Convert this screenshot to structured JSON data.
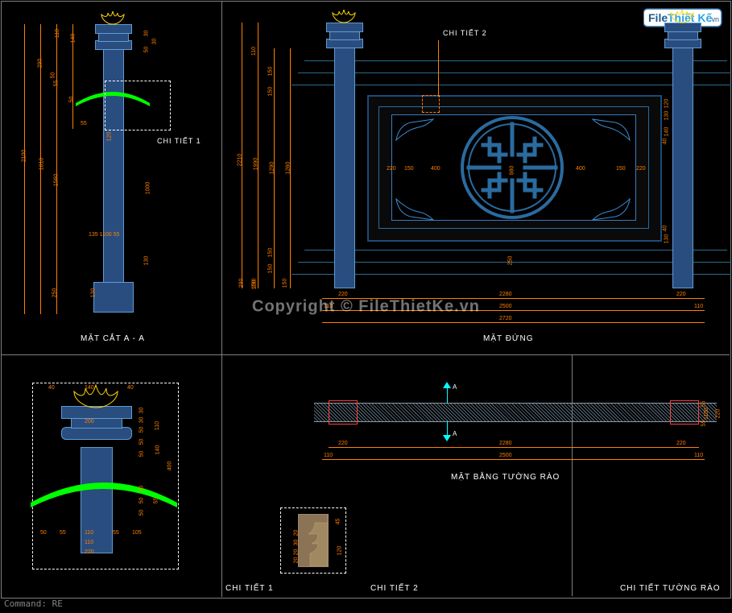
{
  "logo": {
    "text1": "File",
    "text2": "Thiết Kế",
    "text3": ".vn"
  },
  "watermark_center": "Copyright © FileThietKe.vn",
  "command_line": "Command: RE",
  "labels": {
    "section_aa": "MẶT CẮT A - A",
    "detail1_top": "CHI TIẾT 1",
    "detail2_top": "CHI TIẾT 2",
    "elevation": "MẶT ĐỨNG",
    "plan": "MẶT BẰNG TƯỜNG RÀO",
    "detail1_bottom": "CHI TIẾT 1",
    "detail2_bottom": "CHI TIẾT 2",
    "wall_detail": "CHI TIẾT TƯỜNG RÀO"
  },
  "dims": {
    "sec_v": [
      "110",
      "140",
      "30",
      "30",
      "50",
      "290",
      "50",
      "55",
      "50",
      "120",
      "2100",
      "1810",
      "1560",
      "1000",
      "130",
      "1100",
      "55",
      "135",
      "250",
      "130"
    ],
    "elev_v": [
      "110",
      "150",
      "150",
      "290",
      "1990",
      "1290",
      "1260",
      "2210",
      "100",
      "150",
      "150",
      "150",
      "290",
      "120",
      "130",
      "40",
      "140",
      "130",
      "40",
      "250"
    ],
    "elev_h": [
      "110",
      "220",
      "150",
      "400",
      "980",
      "400",
      "150",
      "220",
      "110",
      "220",
      "2280",
      "220",
      "2500",
      "2720"
    ],
    "plan_h": [
      "220",
      "110",
      "2280",
      "2500",
      "220",
      "110"
    ],
    "plan_v": [
      "55",
      "1100",
      "55",
      "220"
    ],
    "d1_h": [
      "40",
      "140",
      "40",
      "55",
      "110",
      "55",
      "105",
      "50",
      "110",
      "200",
      "220"
    ],
    "d1_v": [
      "30",
      "30",
      "50",
      "50",
      "50",
      "110",
      "400",
      "50",
      "50",
      "50",
      "140",
      "55"
    ],
    "d2_v": [
      "45",
      "20",
      "20",
      "30",
      "20",
      "120"
    ],
    "sec_extra": "55"
  },
  "markers": {
    "A_top": "A",
    "A_bot": "A"
  }
}
